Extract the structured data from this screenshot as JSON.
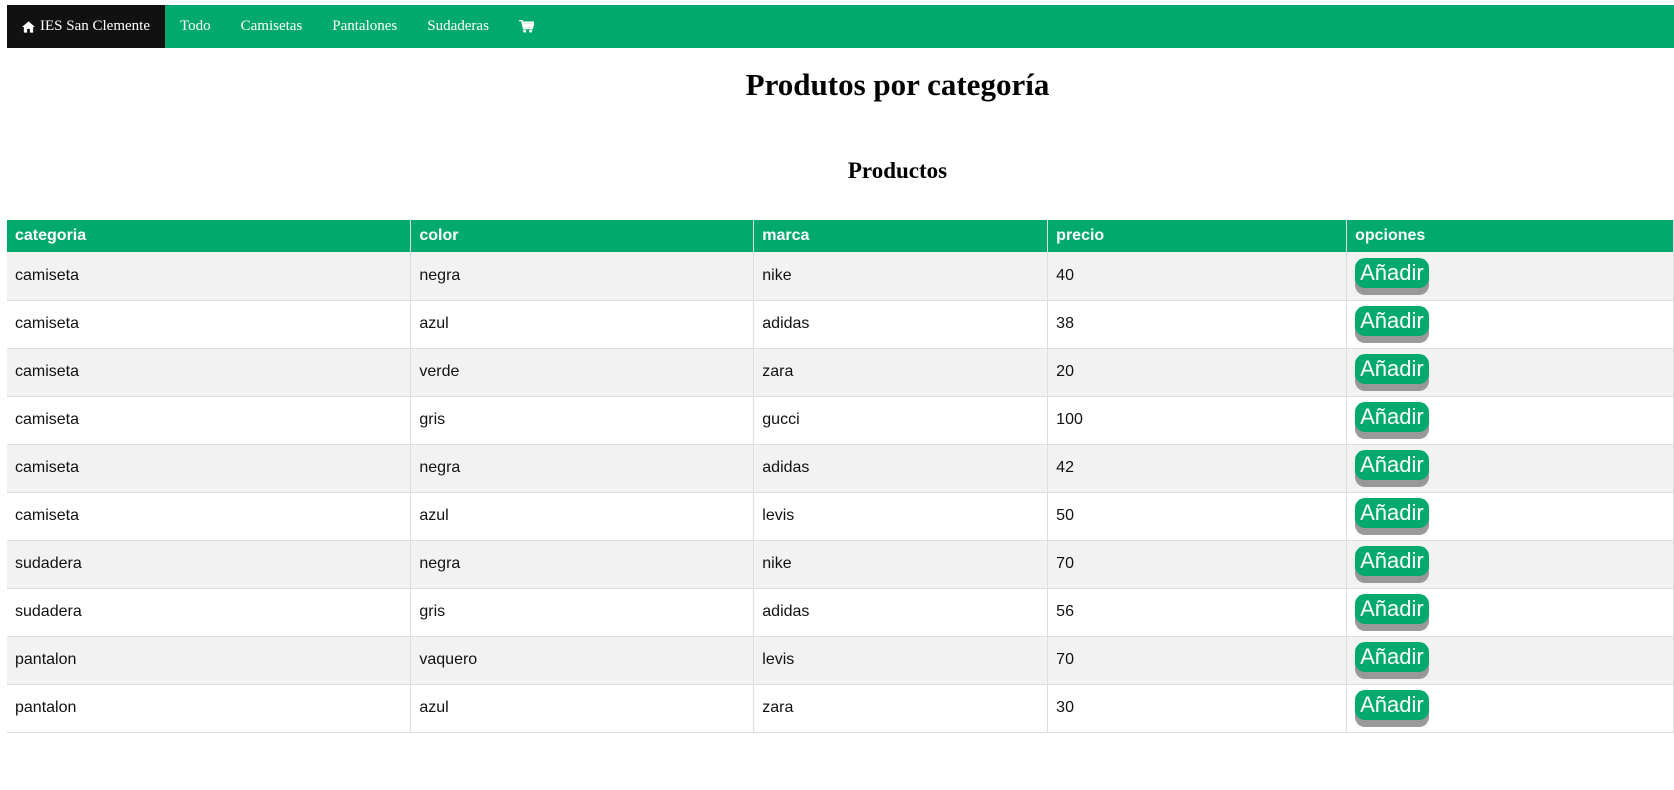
{
  "nav": {
    "home_label": "IES San Clemente",
    "items": [
      {
        "label": "Todo"
      },
      {
        "label": "Camisetas"
      },
      {
        "label": "Pantalones"
      },
      {
        "label": "Sudaderas"
      }
    ],
    "cart_icon": "shopping-cart-icon"
  },
  "colors": {
    "accent": "#04aa6d",
    "active_nav": "#111111",
    "row_stripe": "#f2f2f2",
    "button_shadow": "#999999"
  },
  "page_title": "Produtos por categoría",
  "section_title": "Productos",
  "table": {
    "headers": [
      "categoria",
      "color",
      "marca",
      "precio",
      "opciones"
    ],
    "button_label": "Añadir",
    "rows": [
      {
        "categoria": "camiseta",
        "color": "negra",
        "marca": "nike",
        "precio": "40"
      },
      {
        "categoria": "camiseta",
        "color": "azul",
        "marca": "adidas",
        "precio": "38"
      },
      {
        "categoria": "camiseta",
        "color": "verde",
        "marca": "zara",
        "precio": "20"
      },
      {
        "categoria": "camiseta",
        "color": "gris",
        "marca": "gucci",
        "precio": "100"
      },
      {
        "categoria": "camiseta",
        "color": "negra",
        "marca": "adidas",
        "precio": "42"
      },
      {
        "categoria": "camiseta",
        "color": "azul",
        "marca": "levis",
        "precio": "50"
      },
      {
        "categoria": "sudadera",
        "color": "negra",
        "marca": "nike",
        "precio": "70"
      },
      {
        "categoria": "sudadera",
        "color": "gris",
        "marca": "adidas",
        "precio": "56"
      },
      {
        "categoria": "pantalon",
        "color": "vaquero",
        "marca": "levis",
        "precio": "70"
      },
      {
        "categoria": "pantalon",
        "color": "azul",
        "marca": "zara",
        "precio": "30"
      }
    ]
  }
}
